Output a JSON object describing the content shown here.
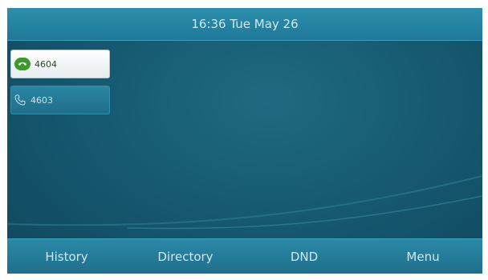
{
  "status_bar": {
    "datetime": "16:36 Tue May 26"
  },
  "lines": [
    {
      "label": "4604",
      "state": "active"
    },
    {
      "label": "4603",
      "state": "idle"
    }
  ],
  "softkeys": {
    "history": "History",
    "directory": "Directory",
    "dnd": "DND",
    "menu": "Menu"
  },
  "colors": {
    "background": "#165a72",
    "bar": "#1f7898",
    "active_icon": "#3a9a2c"
  }
}
